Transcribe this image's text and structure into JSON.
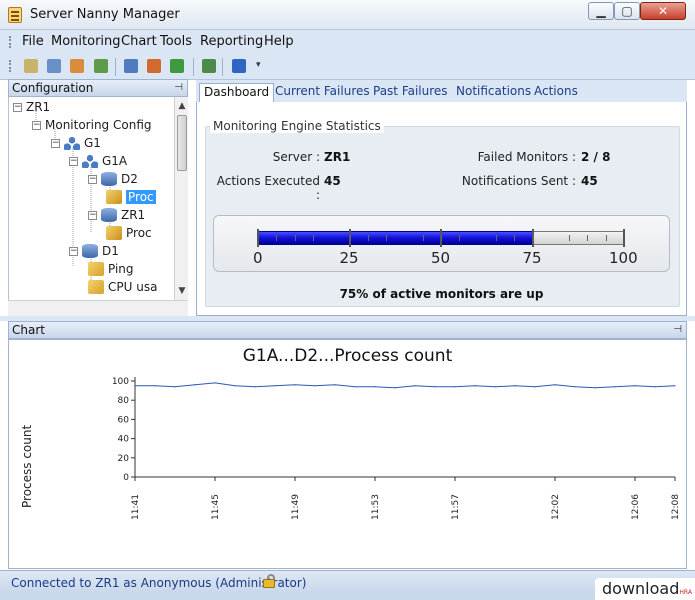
{
  "window": {
    "title": "Server Nanny Manager",
    "minimize": "▁",
    "maximize": "▢",
    "close": "✕"
  },
  "menu": [
    "File",
    "Monitoring",
    "Chart",
    "Tools",
    "Reporting",
    "Help"
  ],
  "toolbar": {
    "icons": [
      {
        "name": "connect-icon",
        "color": "#c9b26a"
      },
      {
        "name": "server-icon",
        "color": "#6b8fc9"
      },
      {
        "name": "monitor-icon",
        "color": "#d88d3c"
      },
      {
        "name": "shield-icon",
        "color": "#5d9a4c"
      },
      {
        "name": "database-icon",
        "color": "#4f7bc1"
      },
      {
        "name": "user-icon",
        "color": "#d06b2d"
      },
      {
        "name": "add-icon",
        "color": "#3f9a3f"
      },
      {
        "name": "chart-icon",
        "color": "#4b8a4b"
      },
      {
        "name": "info-icon",
        "color": "#2f66c4"
      }
    ],
    "overflow": "▾"
  },
  "config_panel": {
    "title": "Configuration",
    "pin": "⊣",
    "tree": [
      {
        "label": "ZR1",
        "icon": "none",
        "toggle": "−"
      },
      {
        "label": "Monitoring Config",
        "icon": "none",
        "toggle": "−"
      },
      {
        "label": "G1",
        "icon": "network",
        "toggle": "−"
      },
      {
        "label": "G1A",
        "icon": "network",
        "toggle": "−"
      },
      {
        "label": "D2",
        "icon": "db",
        "toggle": "−"
      },
      {
        "label": "Proc",
        "icon": "proc",
        "toggle": "",
        "selected": true
      },
      {
        "label": "ZR1",
        "icon": "db",
        "toggle": "−"
      },
      {
        "label": "Proc",
        "icon": "proc",
        "toggle": ""
      },
      {
        "label": "D1",
        "icon": "db",
        "toggle": "−"
      },
      {
        "label": "Ping",
        "icon": "monitor",
        "toggle": ""
      },
      {
        "label": "CPU usa",
        "icon": "monitor",
        "toggle": ""
      }
    ]
  },
  "tabs": [
    "Dashboard",
    "Current Failures",
    "Past Failures",
    "Notifications",
    "Actions"
  ],
  "dashboard": {
    "group_title": "Monitoring Engine Statistics",
    "server_label": "Server :",
    "server_value": "ZR1",
    "actions_label": "Actions Executed :",
    "actions_value": "45",
    "failed_label": "Failed Monitors :",
    "failed_value": "2 / 8",
    "notif_label": "Notifications Sent :",
    "notif_value": "45",
    "gauge": {
      "value": 75,
      "min": 0,
      "max": 100,
      "labels": [
        "0",
        "25",
        "50",
        "75",
        "100"
      ],
      "fill_color": "#1010d8"
    },
    "caption": "75% of active monitors are up"
  },
  "chart_panel": {
    "title": "Chart",
    "pin": "⊣"
  },
  "chart_data": {
    "type": "line",
    "title": "G1A...D2...Process count",
    "ylabel": "Process count",
    "xlabel": "",
    "ylim": [
      0,
      100
    ],
    "yticks": [
      "0",
      "20",
      "40",
      "60",
      "80",
      "100"
    ],
    "xticks": [
      "11:41",
      "11:45",
      "11:49",
      "11:53",
      "11:57",
      "12:02",
      "12:06",
      "12:08"
    ],
    "grid": false,
    "series": [
      {
        "color": "#2c56b8",
        "x": [
          "11:41",
          "11:42",
          "11:43",
          "11:44",
          "11:45",
          "11:46",
          "11:47",
          "11:48",
          "11:49",
          "11:50",
          "11:51",
          "11:52",
          "11:53",
          "11:54",
          "11:55",
          "11:56",
          "11:57",
          "11:58",
          "11:59",
          "12:00",
          "12:01",
          "12:02",
          "12:03",
          "12:04",
          "12:05",
          "12:06",
          "12:07",
          "12:08"
        ],
        "values": [
          95,
          95,
          94,
          96,
          98,
          95,
          94,
          95,
          96,
          95,
          96,
          94,
          94,
          93,
          95,
          94,
          94,
          95,
          94,
          95,
          94,
          96,
          94,
          93,
          94,
          95,
          94,
          95
        ]
      }
    ]
  },
  "status": {
    "text": "Connected to ZR1 as Anonymous (Administrator)"
  },
  "watermark": {
    "text": "download",
    "sub": "HRA"
  }
}
